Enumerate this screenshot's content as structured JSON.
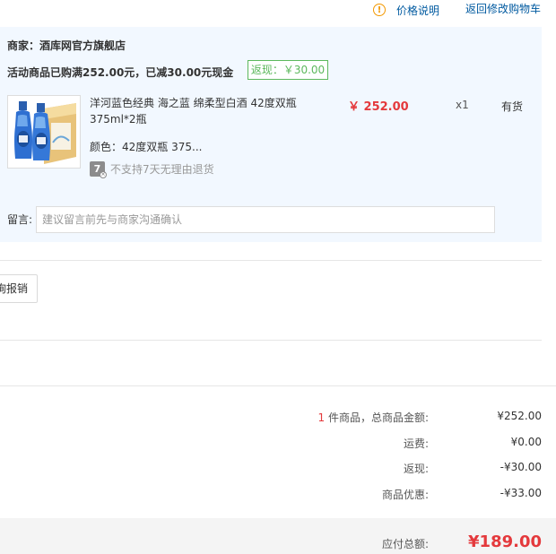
{
  "header": {
    "price_info": "价格说明",
    "back_to_cart": "返回修改购物车"
  },
  "shop": {
    "name": "商家：酒库网官方旗舰店",
    "promo": "活动商品已购满252.00元，已减30.00元现金",
    "rebate": "返现：￥30.00"
  },
  "product": {
    "title": "洋河蓝色经典 海之蓝 绵柔型白酒 42度双瓶375ml*2瓶",
    "price": "￥ 252.00",
    "qty": "x1",
    "stock": "有货",
    "spec_label": "颜色：",
    "spec_value": "42度双瓶 375...",
    "return_policy": "不支持7天无理由退货",
    "return_icon_text": "7"
  },
  "note": {
    "label": "留言:",
    "placeholder": "建议留言前先与商家沟通确认"
  },
  "expense_button": "询报销",
  "summary": {
    "count": "1",
    "count_label": "件商品，总商品金额:",
    "goods_total": "¥252.00",
    "shipping_label": "运费:",
    "shipping": "¥0.00",
    "rebate_label": "返现:",
    "rebate": "-¥30.00",
    "discount_label": "商品优惠:",
    "discount": "-¥33.00",
    "payable_label": "应付总额:",
    "payable": "¥189.00"
  },
  "colors": {
    "link": "#005aa0",
    "price_red": "#e4393c",
    "panel_bg": "#f2f8ff",
    "rebate_green": "#5cb85c",
    "warning_orange": "#f39800"
  }
}
